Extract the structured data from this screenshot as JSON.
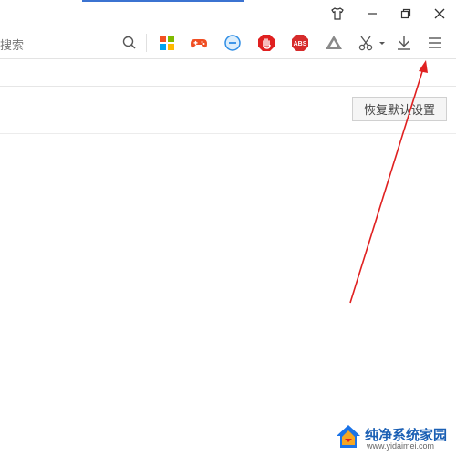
{
  "toolbar": {
    "search_label": "搜索"
  },
  "window_controls": [
    "skin",
    "minimize",
    "restore",
    "close"
  ],
  "extensions": [
    {
      "name": "apps-grid-icon",
      "color": "#1a73e8"
    },
    {
      "name": "game-controller-icon",
      "color": "#f04e23"
    },
    {
      "name": "minus-circle-icon",
      "color": "#2e8de5"
    },
    {
      "name": "stop-hand-icon",
      "color": "#e02020"
    },
    {
      "name": "abs-adblock-icon",
      "color": "#d62b2b"
    },
    {
      "name": "triangle-icon",
      "color": "#8a8a8a"
    },
    {
      "name": "scissors-icon",
      "color": "#555555"
    },
    {
      "name": "download-icon",
      "color": "#555555"
    },
    {
      "name": "menu-icon",
      "color": "#555555"
    }
  ],
  "settings": {
    "restore_defaults_label": "恢复默认设置"
  },
  "annotation": {
    "arrow_color": "#e02020"
  },
  "watermark": {
    "text": "纯净系统家园",
    "url": "www.yidaimei.com"
  }
}
